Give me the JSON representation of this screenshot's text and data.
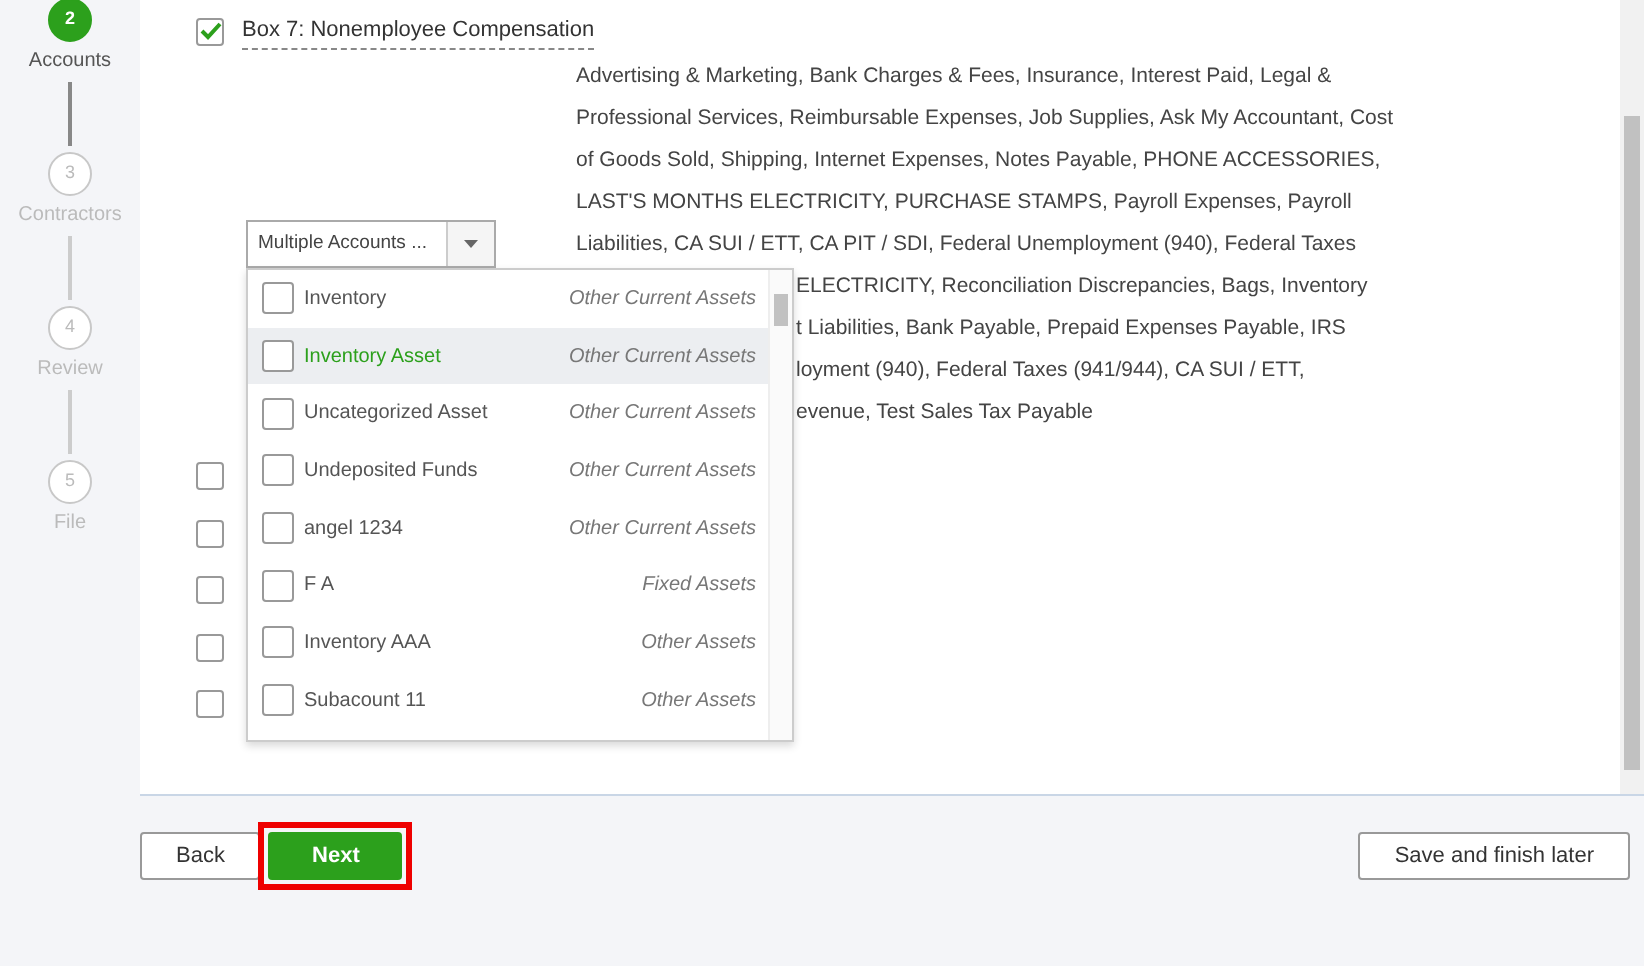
{
  "steps": [
    {
      "number": "2",
      "label": "Accounts",
      "selected": true
    },
    {
      "number": "3",
      "label": "Contractors",
      "selected": false
    },
    {
      "number": "4",
      "label": "Review",
      "selected": false
    },
    {
      "number": "5",
      "label": "File",
      "selected": false
    }
  ],
  "box7": {
    "label": "Box 7: Nonemployee Compensation",
    "checked": true
  },
  "accounts_text": {
    "lines": [
      "Advertising & Marketing, Bank Charges & Fees, Insurance, Interest Paid, Legal &",
      "Professional Services, Reimbursable Expenses, Job Supplies, Ask My Accountant, Cost",
      "of Goods Sold, Shipping, Internet Expenses, Notes Payable, PHONE ACCESSORIES,",
      "LAST'S MONTHS ELECTRICITY, PURCHASE STAMPS, Payroll Expenses, Payroll",
      "Liabilities, CA SUI / ETT, CA PIT / SDI, Federal Unemployment (940), Federal Taxes"
    ],
    "partly_hidden_lines": [
      "ELECTRICITY, Reconciliation Discrepancies, Bags, Inventory",
      "t Liabilities, Bank Payable, Prepaid Expenses Payable, IRS",
      "loyment (940), Federal Taxes (941/944), CA SUI / ETT,",
      "evenue, Test Sales Tax Payable"
    ]
  },
  "other_boxes": [
    {
      "checked": false
    },
    {
      "checked": false
    },
    {
      "checked": false
    },
    {
      "checked": false
    },
    {
      "checked": false
    }
  ],
  "account_select": {
    "value": "Multiple Accounts ...",
    "expanded": true,
    "options": [
      {
        "name": "Inventory",
        "type": "Other Current Assets",
        "checked": false,
        "highlighted": false
      },
      {
        "name": "Inventory Asset",
        "type": "Other Current Assets",
        "checked": false,
        "highlighted": true
      },
      {
        "name": "Uncategorized Asset",
        "type": "Other Current Assets",
        "checked": false,
        "highlighted": false
      },
      {
        "name": "Undeposited Funds",
        "type": "Other Current Assets",
        "checked": false,
        "highlighted": false
      },
      {
        "name": "angel 1234",
        "type": "Other Current Assets",
        "checked": false,
        "highlighted": false
      },
      {
        "name": "F A",
        "type": "Fixed Assets",
        "checked": false,
        "highlighted": false
      },
      {
        "name": "Inventory AAA",
        "type": "Other Assets",
        "checked": false,
        "highlighted": false
      },
      {
        "name": "Subacount 11",
        "type": "Other Assets",
        "checked": false,
        "highlighted": false
      }
    ]
  },
  "footer": {
    "back": "Back",
    "next": {
      "label": "Next",
      "highlighted": true
    },
    "save": "Save and finish later"
  }
}
